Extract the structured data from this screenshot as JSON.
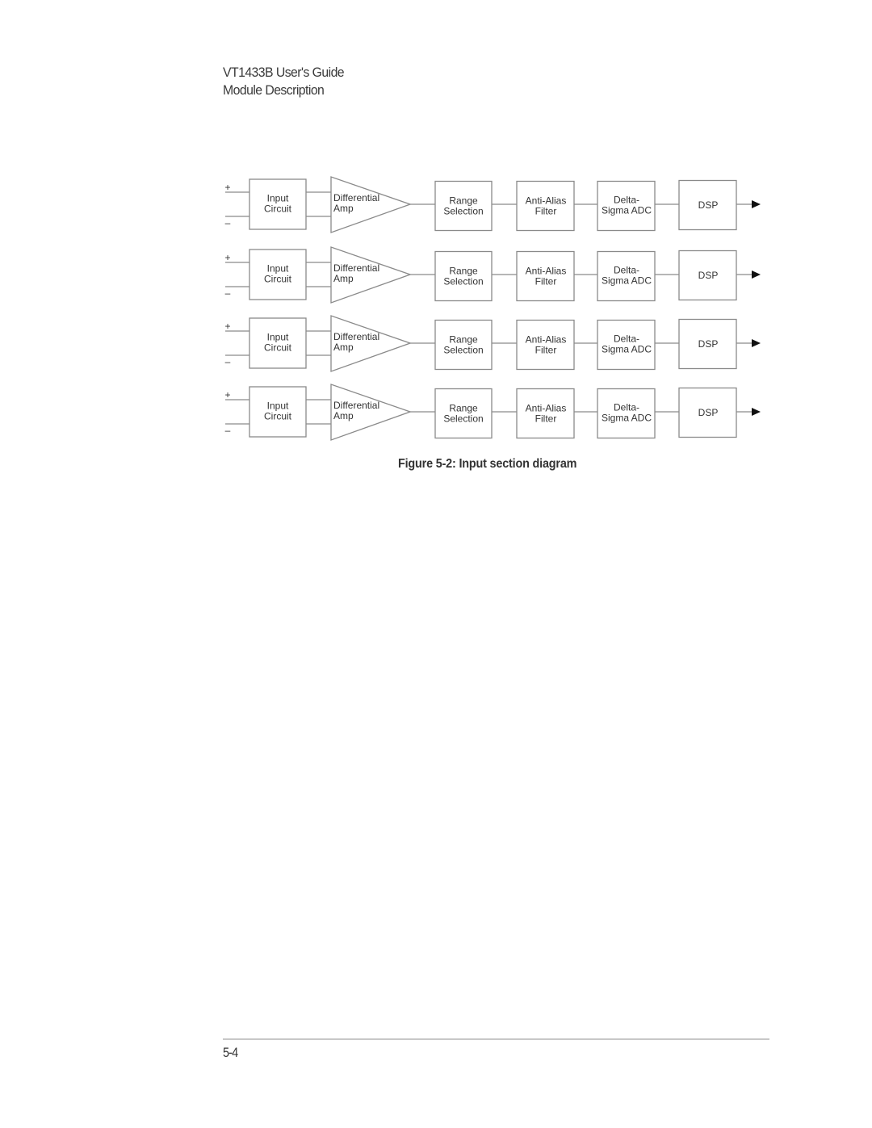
{
  "header": {
    "title": "VT1433B User's Guide",
    "section": "Module Description"
  },
  "diagram": {
    "channel_count": 4,
    "input_labels": {
      "plus": "+",
      "minus": "–"
    },
    "blocks": [
      {
        "id": "input-circuit",
        "lines": [
          "Input",
          "Circuit"
        ]
      },
      {
        "id": "differential-amp",
        "lines": [
          "Differential",
          "Amp"
        ]
      },
      {
        "id": "range-selection",
        "lines": [
          "Range",
          "Selection"
        ]
      },
      {
        "id": "anti-alias-filter",
        "lines": [
          "Anti-Alias",
          "Filter"
        ]
      },
      {
        "id": "delta-sigma-adc",
        "lines": [
          "Delta-",
          "Sigma ADC"
        ]
      },
      {
        "id": "dsp",
        "lines": [
          "DSP"
        ]
      }
    ],
    "output": "arrow"
  },
  "caption": "Figure 5-2:  Input section diagram",
  "footer": {
    "page_number": "5-4"
  }
}
